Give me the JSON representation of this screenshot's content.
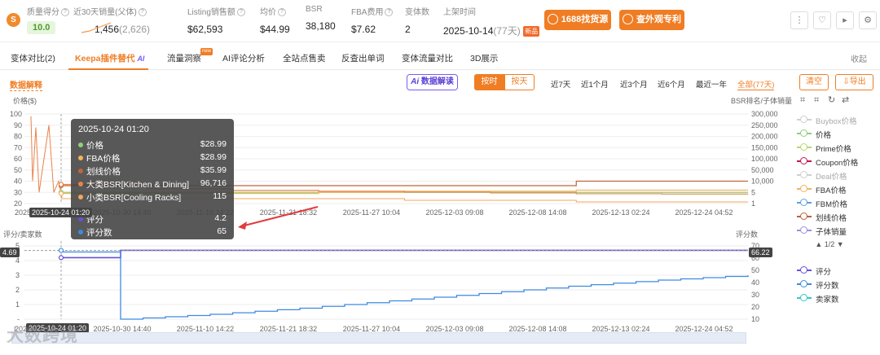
{
  "header": {
    "logo_char": "S",
    "metrics": [
      {
        "label": "质量得分",
        "value": "10.0"
      },
      {
        "label": "近30天销量(父体)",
        "value": "1,456",
        "sub": "(2,626)"
      },
      {
        "label": "Listing销售额",
        "value": "$62,593"
      },
      {
        "label": "均价",
        "value": "$44.99"
      },
      {
        "label": "BSR",
        "value": "38,180"
      },
      {
        "label": "FBA费用",
        "value": "$7.62"
      },
      {
        "label": "变体数",
        "value": "2"
      },
      {
        "label": "上架时间",
        "value": "2025-10-14",
        "sub": "(77天)",
        "badge": "新品"
      }
    ],
    "btn_1688": "1688找货源",
    "btn_patent": "查外观专利"
  },
  "tabs": [
    "变体对比(2)",
    "Keepa插件替代",
    "流量洞察",
    "AI评论分析",
    "全站点售卖",
    "反查出单词",
    "变体流量对比",
    "3D展示"
  ],
  "tab_ai": "AI",
  "tab_hot": "new",
  "collapse": "收起",
  "toolbar": {
    "data_explain": "数据解释",
    "ai_read": "数据解读",
    "by_hour": "按时",
    "by_day": "按天",
    "ranges": [
      "近7天",
      "近1个月",
      "近3个月",
      "近6个月",
      "最近一年",
      "全部(77天)"
    ],
    "clear": "清空",
    "export": "导出"
  },
  "chart_data": [
    {
      "type": "line",
      "title": "",
      "ylabel": "价格($)",
      "y2label": "BSR排名/子体销量",
      "ylim": [
        20,
        100
      ],
      "y2_ticks": [
        "300,000",
        "250,000",
        "200,000",
        "150,000",
        "100,000",
        "50,000",
        "10,000",
        "5",
        "1"
      ],
      "x_ticks": [
        "2025-10-...",
        "2025-10-30 14:40",
        "2025-11-10 14:22",
        "2025-11-21 18:32",
        "2025-11-27 10:04",
        "2025-12-03 09:08",
        "2025-12-08 14:08",
        "2025-12-13 02:24",
        "2025-12-24 04:52"
      ],
      "y_ticks": [
        "100",
        "90",
        "80",
        "70",
        "60",
        "50",
        "40",
        "30",
        "20"
      ],
      "series": [
        {
          "name": "价格",
          "color": "#8fd07b",
          "values": [
            30,
            30,
            30,
            30,
            30,
            30,
            30,
            30,
            30
          ]
        },
        {
          "name": "FBA价格",
          "color": "#f5b35a",
          "values": [
            29,
            29,
            29,
            30,
            31,
            31,
            32,
            32,
            32
          ]
        },
        {
          "name": "划线价格",
          "color": "#c1643a",
          "values": [
            36,
            36,
            36,
            36,
            36,
            36,
            40,
            40,
            40
          ]
        },
        {
          "name": "大类BSR",
          "color": "#e8834a",
          "values": [
            96716,
            70000,
            60000,
            55000,
            50000,
            45000,
            40000,
            38000,
            38180
          ]
        }
      ]
    },
    {
      "type": "line",
      "ylabel": "评分/卖家数",
      "y2label": "评分数",
      "ylim": [
        0,
        5
      ],
      "y2lim": [
        10,
        70
      ],
      "y_ticks": [
        "5",
        "4",
        "3",
        "2",
        "1",
        "-"
      ],
      "y2_ticks": [
        "70",
        "60",
        "50",
        "40",
        "30",
        "20",
        "10"
      ],
      "x_ticks": [
        "2025-10-...",
        "2025-10-30 14:40",
        "2025-11-10 14:22",
        "2025-11-21 18:32",
        "2025-11-27 10:04",
        "2025-12-03 09:08",
        "2025-12-08 14:08",
        "2025-12-13 02:24",
        "2025-12-24 04:52"
      ],
      "series": [
        {
          "name": "评分",
          "color": "#6a4fd6",
          "values": [
            4.2,
            4.7,
            4.7,
            4.7,
            4.7,
            4.7,
            4.7,
            4.7,
            4.7
          ]
        },
        {
          "name": "评分数",
          "color": "#3f8ae0",
          "values": [
            65,
            10,
            14,
            19,
            25,
            31,
            37,
            42,
            46
          ]
        }
      ]
    }
  ],
  "legend": [
    {
      "name": "Buybox价格",
      "color": "#cfcfcf",
      "dim": true
    },
    {
      "name": "价格",
      "color": "#8fd07b",
      "dim": false
    },
    {
      "name": "Prime价格",
      "color": "#b7d86a",
      "dim": false
    },
    {
      "name": "Coupon价格",
      "color": "#c0174e",
      "dim": false
    },
    {
      "name": "Deal价格",
      "color": "#cfcfcf",
      "dim": true
    },
    {
      "name": "FBA价格",
      "color": "#f5b35a",
      "dim": false
    },
    {
      "name": "FBM价格",
      "color": "#5d9fe0",
      "dim": false
    },
    {
      "name": "划线价格",
      "color": "#b5623e",
      "dim": false
    },
    {
      "name": "子体销量",
      "color": "#9b8ee6",
      "dim": false
    }
  ],
  "legend_page": "▲ 1/2 ▼",
  "legend2": [
    {
      "name": "评分",
      "color": "#6a4fd6"
    },
    {
      "name": "评分数",
      "color": "#3f8ae0"
    },
    {
      "name": "卖家数",
      "color": "#37c7c7"
    }
  ],
  "tooltip": {
    "time": "2025-10-24 01:20",
    "rows": [
      {
        "name": "价格",
        "value": "$28.99",
        "color": "#8fd07b"
      },
      {
        "name": "FBA价格",
        "value": "$28.99",
        "color": "#f5b35a"
      },
      {
        "name": "划线价格",
        "value": "$35.99",
        "color": "#c1643a"
      },
      {
        "name": "大类BSR[Kitchen & Dining]",
        "value": "96,716",
        "color": "#e8834a"
      },
      {
        "name": "小类BSR[Cooling Racks]",
        "value": "115",
        "color": "#f5a55a"
      }
    ],
    "rows2": [
      {
        "name": "评分",
        "value": "4.2",
        "color": "#6a4fd6"
      },
      {
        "name": "评分数",
        "value": "65",
        "color": "#3f8ae0"
      }
    ]
  },
  "axis_badges": {
    "top_x": "2025-10-24 01:20",
    "bottom_x": "2025-10-24 01:20",
    "left_y": "4.69",
    "right_y": "66.22"
  },
  "watermark": "大数跨境"
}
